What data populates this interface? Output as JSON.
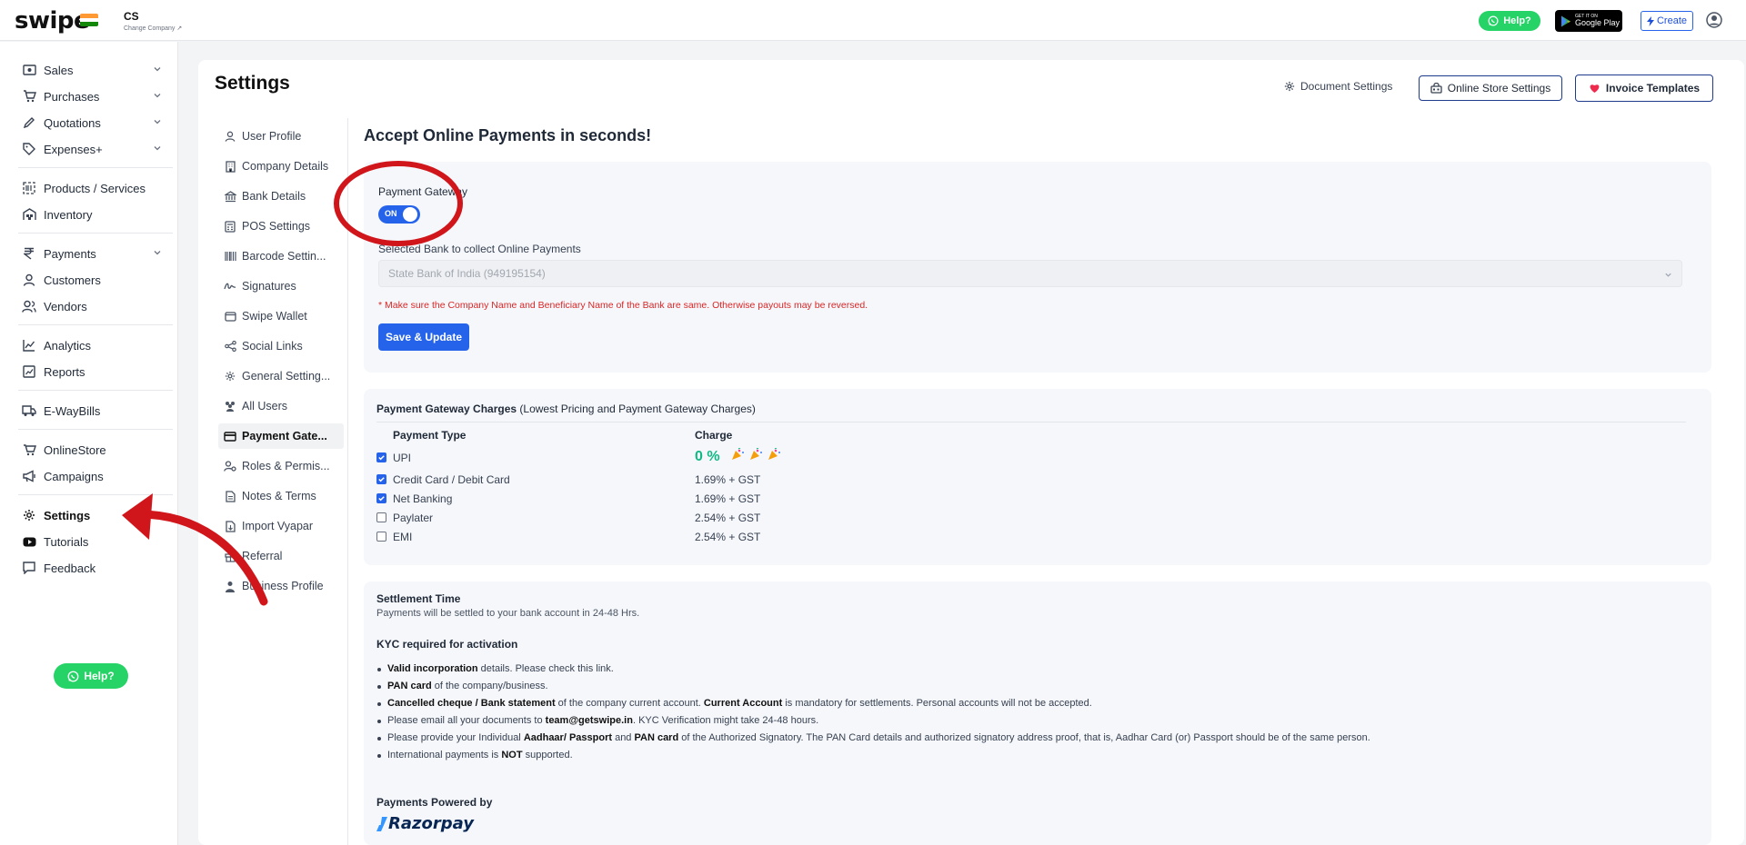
{
  "colors": {
    "brand_blue": "#2563eb",
    "whatsapp_green": "#25d366",
    "annotation_red": "#d0161b",
    "warning_red": "#dc2626",
    "zero_charge_green": "#10b981"
  },
  "topbar": {
    "logo": "swipe",
    "company_name": "CS",
    "company_change": "Change Company ↗",
    "help_label": "Help?",
    "gplay_small": "GET IT ON",
    "gplay_big": "Google Play",
    "create_label": "Create"
  },
  "sidebar": {
    "items": [
      {
        "label": "Sales",
        "icon": "cash-icon"
      },
      {
        "label": "Purchases",
        "icon": "cart-icon"
      },
      {
        "label": "Quotations",
        "icon": "pen-icon"
      },
      {
        "label": "Expenses+",
        "icon": "tag-icon"
      },
      {
        "label": "Products / Services",
        "icon": "box-icon"
      },
      {
        "label": "Inventory",
        "icon": "warehouse-icon"
      },
      {
        "label": "Payments",
        "icon": "rupee-icon"
      },
      {
        "label": "Customers",
        "icon": "user-icon"
      },
      {
        "label": "Vendors",
        "icon": "users-icon"
      },
      {
        "label": "Analytics",
        "icon": "chart-icon"
      },
      {
        "label": "Reports",
        "icon": "report-icon"
      },
      {
        "label": "E-WayBills",
        "icon": "truck-icon"
      },
      {
        "label": "OnlineStore",
        "icon": "store-icon"
      },
      {
        "label": "Campaigns",
        "icon": "megaphone-icon"
      },
      {
        "label": "Settings",
        "icon": "gear-icon"
      },
      {
        "label": "Tutorials",
        "icon": "youtube-icon"
      },
      {
        "label": "Feedback",
        "icon": "message-icon"
      }
    ],
    "help_label": "Help?"
  },
  "header": {
    "title": "Settings",
    "document_settings": "Document Settings",
    "online_store_settings": "Online Store Settings",
    "invoice_templates": "Invoice Templates"
  },
  "submenu": {
    "items": [
      {
        "label": "User Profile"
      },
      {
        "label": "Company Details"
      },
      {
        "label": "Bank Details"
      },
      {
        "label": "POS Settings"
      },
      {
        "label": "Barcode Settin..."
      },
      {
        "label": "Signatures"
      },
      {
        "label": "Swipe Wallet"
      },
      {
        "label": "Social Links"
      },
      {
        "label": "General Setting..."
      },
      {
        "label": "All Users"
      },
      {
        "label": "Payment Gate..."
      },
      {
        "label": "Roles & Permis..."
      },
      {
        "label": "Notes & Terms"
      },
      {
        "label": "Import Vyapar"
      },
      {
        "label": "Referral"
      },
      {
        "label": "Business Profile"
      }
    ],
    "active_index": 10
  },
  "content": {
    "title": "Accept Online Payments in seconds!",
    "gateway": {
      "label": "Payment Gateway",
      "toggle_text": "ON",
      "toggle_on": true,
      "bank_label": "Selected Bank to collect Online Payments",
      "bank_value": "State Bank of India (949195154)",
      "warning": "* Make sure the Company Name and Beneficiary Name of the Bank are same. Otherwise payouts may be reversed.",
      "save_label": "Save & Update"
    },
    "charges": {
      "title_bold": "Payment Gateway Charges",
      "title_rest": " (Lowest Pricing and Payment Gateway Charges)",
      "col_type": "Payment Type",
      "col_charge": "Charge",
      "rows": [
        {
          "type": "UPI",
          "charge": "0 %",
          "checked": true
        },
        {
          "type": "Credit Card / Debit Card",
          "charge": "1.69% + GST",
          "checked": true
        },
        {
          "type": "Net Banking",
          "charge": "1.69% + GST",
          "checked": true
        },
        {
          "type": "Paylater",
          "charge": "2.54% + GST",
          "checked": false
        },
        {
          "type": "EMI",
          "charge": "2.54% + GST",
          "checked": false
        }
      ]
    },
    "settlement": {
      "title": "Settlement Time",
      "subtitle": "Payments will be settled to your bank account in 24-48 Hrs.",
      "kyc_title": "KYC required for activation",
      "kyc": [
        {
          "b1": "Valid incorporation",
          "t1": " details. Please check this link."
        },
        {
          "b1": "PAN card",
          "t1": " of the company/business."
        },
        {
          "b1": "Cancelled cheque / Bank statement",
          "t1": " of the company current account. ",
          "b2": "Current Account",
          "t2": " is mandatory for settlements. Personal accounts will not be accepted."
        },
        {
          "t0": "Please email all your documents to ",
          "b1": "team@getswipe.in",
          "t1": ". KYC Verification might take 24-48 hours."
        },
        {
          "t0": "Please provide your Individual ",
          "b1": "Aadhaar/ Passport",
          "t1": " and ",
          "b2": "PAN card",
          "t2": " of the Authorized Signatory. The PAN Card details and authorized signatory address proof, that is, Aadhar Card (or) Passport should be of the same person."
        },
        {
          "t0": "International payments is ",
          "b1": "NOT",
          "t1": " supported."
        }
      ],
      "powered_by": "Payments Powered by",
      "razorpay": "Razorpay"
    }
  }
}
